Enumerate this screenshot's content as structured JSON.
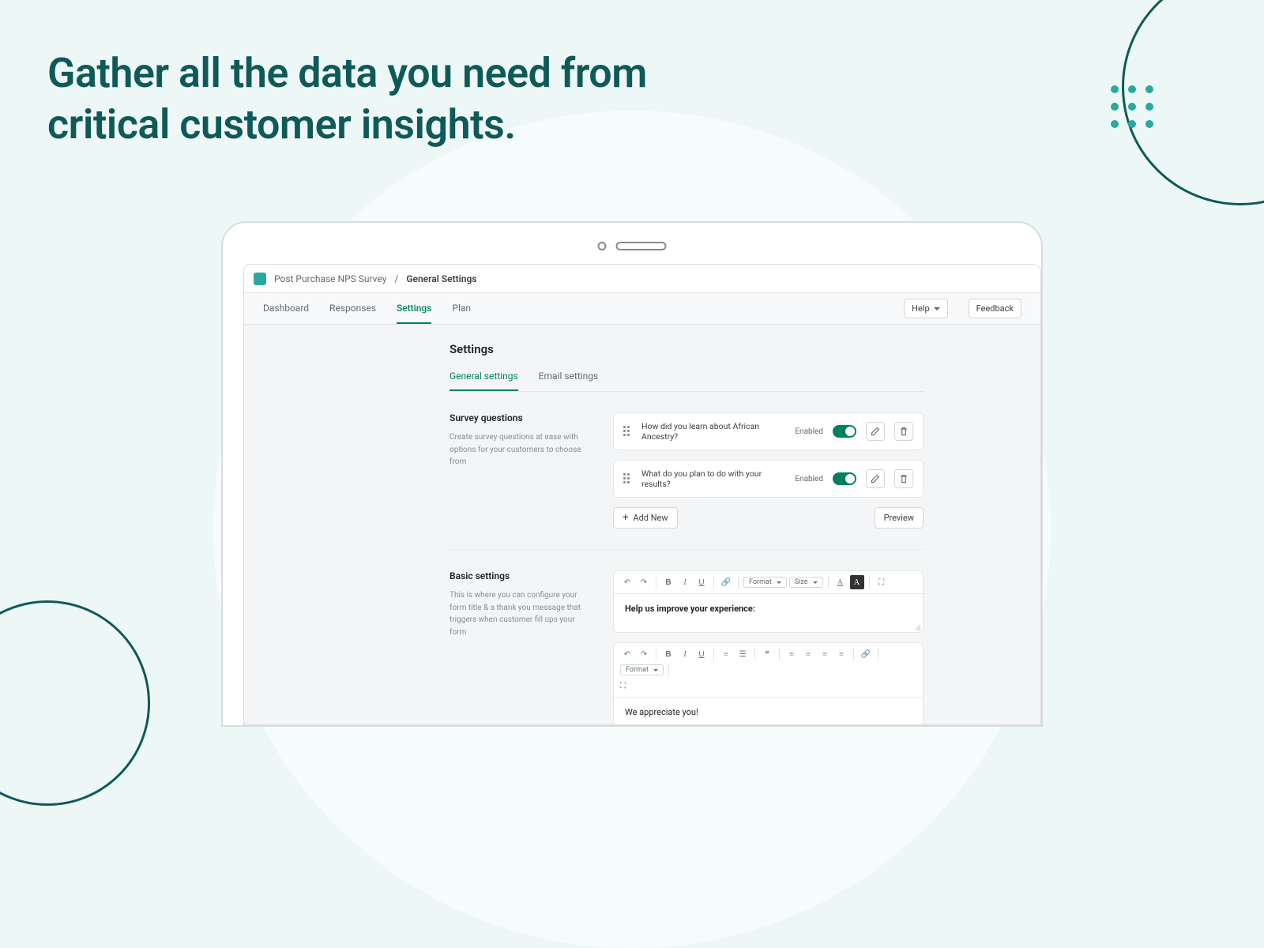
{
  "headline": "Gather all the data you need from critical customer insights.",
  "breadcrumb": {
    "app": "Post Purchase NPS Survey",
    "sep": "/",
    "page": "General Settings"
  },
  "topTabs": {
    "items": [
      "Dashboard",
      "Responses",
      "Settings",
      "Plan"
    ],
    "activeIndex": 2
  },
  "actions": {
    "help": "Help",
    "feedback": "Feedback"
  },
  "pageTitle": "Settings",
  "subTabs": {
    "items": [
      "General settings",
      "Email settings"
    ],
    "activeIndex": 0
  },
  "surveySection": {
    "title": "Survey questions",
    "desc": "Create survey questions at ease with options for your customers to choose from",
    "questions": [
      {
        "text": "How did you learn about African Ancestry?",
        "status": "Enabled"
      },
      {
        "text": "What do you plan to do with your results?",
        "status": "Enabled"
      }
    ],
    "addNew": "Add New",
    "preview": "Preview"
  },
  "basicSection": {
    "title": "Basic settings",
    "desc": "This is where you can configure your form title & a thank you message that triggers when customer fill ups your form",
    "editor1": {
      "text": "Help us improve your experience:",
      "formatLabel": "Format",
      "sizeLabel": "Size"
    },
    "editor2": {
      "text": "We appreciate you!",
      "formatLabel": "Format"
    }
  }
}
